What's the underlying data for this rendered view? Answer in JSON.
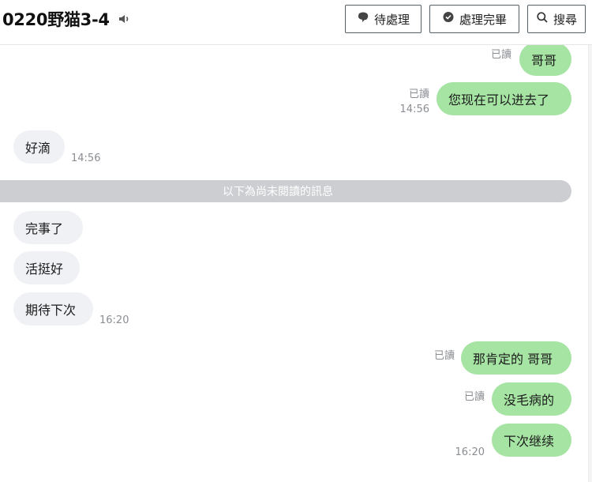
{
  "header": {
    "title": "0220野猫3-4",
    "buttons": {
      "pending": "待處理",
      "done": "處理完畢",
      "search": "搜尋"
    }
  },
  "messages": {
    "m1": {
      "text": "哥哥",
      "read": "已讀"
    },
    "m2": {
      "text": "您现在可以进去了",
      "read": "已讀",
      "time": "14:56"
    },
    "m3": {
      "text": "好滴",
      "time": "14:56"
    },
    "divider": "以下為尚未閱讀的訊息",
    "m4": {
      "text": "完事了"
    },
    "m5": {
      "text": "活挺好"
    },
    "m6": {
      "text": "期待下次",
      "time": "16:20"
    },
    "m7": {
      "text": "那肯定的 哥哥",
      "read": "已讀"
    },
    "m8": {
      "text": "没毛病的",
      "read": "已讀"
    },
    "m9": {
      "text": "下次继续",
      "time": "16:20"
    }
  },
  "colors": {
    "outgoing_bubble": "#a6e4a3",
    "incoming_bubble": "#f0f1f5",
    "divider": "#cdced1"
  },
  "icons": [
    "speaker-icon",
    "chat-bubble-icon",
    "check-bubble-icon",
    "search-icon"
  ]
}
